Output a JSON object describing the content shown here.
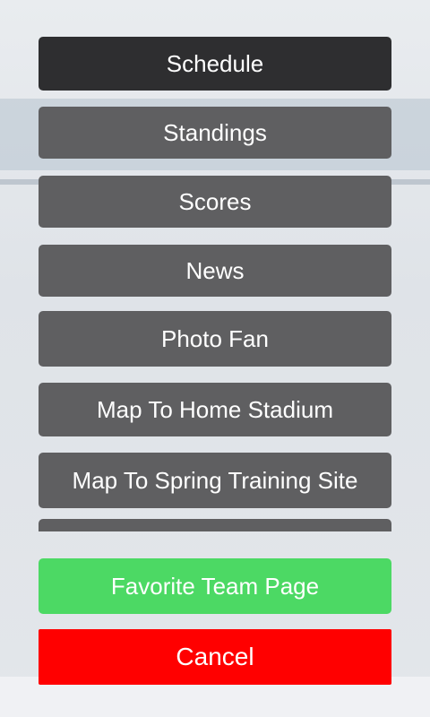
{
  "menu": {
    "schedule_label": "Schedule",
    "standings_label": "Standings",
    "scores_label": "Scores",
    "news_label": "News",
    "photo_fan_label": "Photo Fan",
    "map_home_label": "Map To Home Stadium",
    "map_spring_label": "Map To Spring Training Site",
    "favorite_team_label": "Favorite Team Page",
    "cancel_label": "Cancel"
  },
  "colors": {
    "dark_button": "#2e2e30",
    "gray_button": "#5f5f61",
    "favorite_button": "#4cd964",
    "cancel_button": "#ff0000"
  }
}
